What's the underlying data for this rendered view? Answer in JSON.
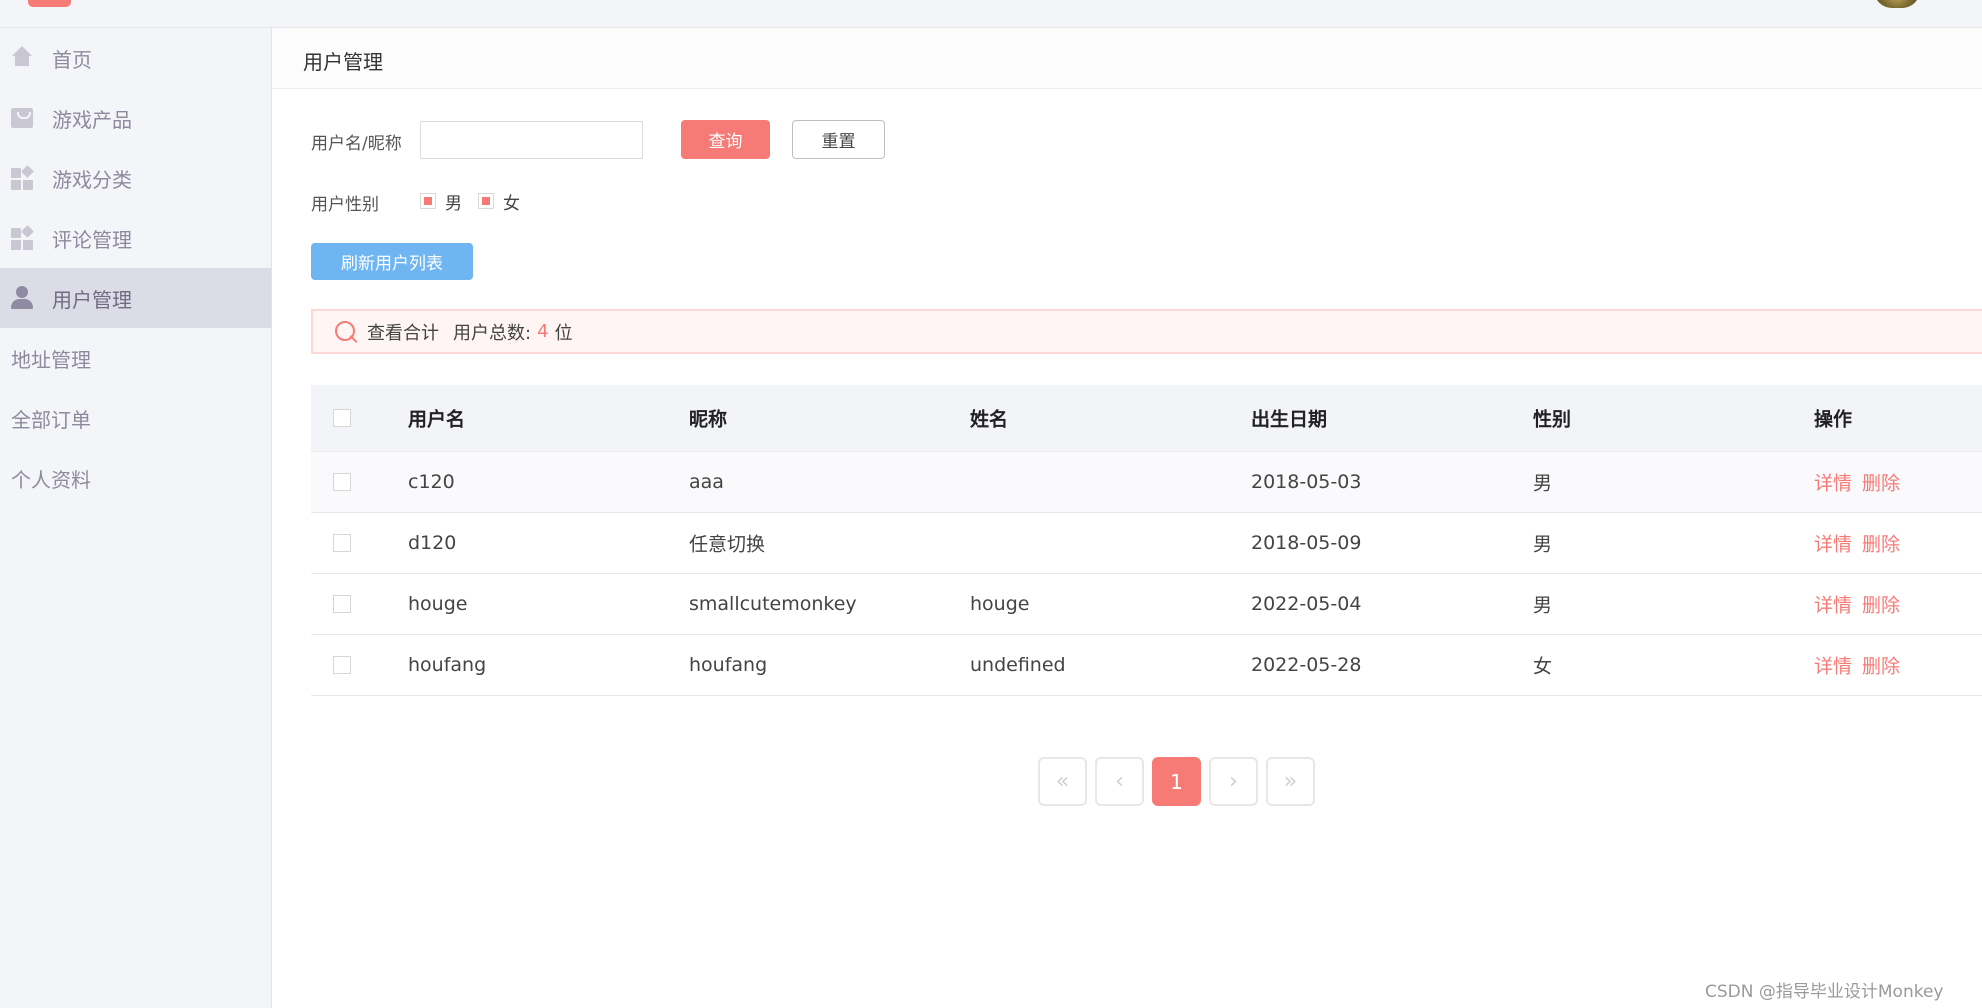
{
  "sidebar": {
    "items": [
      {
        "label": "首页",
        "icon": "home-icon"
      },
      {
        "label": "游戏产品",
        "icon": "shopping-bag-icon"
      },
      {
        "label": "游戏分类",
        "icon": "apps-grid-icon"
      },
      {
        "label": "评论管理",
        "icon": "apps-grid-icon"
      },
      {
        "label": "用户管理",
        "icon": "user-icon",
        "active": true
      },
      {
        "label": "地址管理"
      },
      {
        "label": "全部订单"
      },
      {
        "label": "个人资料"
      }
    ]
  },
  "header": {
    "title": "用户管理"
  },
  "filters": {
    "name_label": "用户名/昵称",
    "name_value": "",
    "query_label": "查询",
    "reset_label": "重置",
    "gender_label": "用户性别",
    "gender_options": [
      "男",
      "女"
    ],
    "refresh_label": "刷新用户列表"
  },
  "summary": {
    "title": "查看合计",
    "total_label": "用户总数:",
    "total_count": "4",
    "unit": "位"
  },
  "table": {
    "columns": [
      "用户名",
      "昵称",
      "姓名",
      "出生日期",
      "性别",
      "操作"
    ],
    "rows": [
      {
        "username": "c120",
        "nickname": "aaa",
        "name": "",
        "birth": "2018-05-03",
        "gender": "男"
      },
      {
        "username": "d120",
        "nickname": "任意切换",
        "name": "",
        "birth": "2018-05-09",
        "gender": "男"
      },
      {
        "username": "houge",
        "nickname": "smallcutemonkey",
        "name": "houge",
        "birth": "2022-05-04",
        "gender": "男"
      },
      {
        "username": "houfang",
        "nickname": "houfang",
        "name": "undefined",
        "birth": "2022-05-28",
        "gender": "女"
      }
    ],
    "action_detail": "详情",
    "action_delete": "删除"
  },
  "pagination": {
    "first": "«",
    "prev": "‹",
    "current": "1",
    "next": "›",
    "last": "»"
  },
  "watermark": "CSDN @指导毕业设计Monkey",
  "colors": {
    "accent": "#f67b77",
    "refresh": "#6fb5f2",
    "sidebar_bg": "#f4f5f9"
  }
}
